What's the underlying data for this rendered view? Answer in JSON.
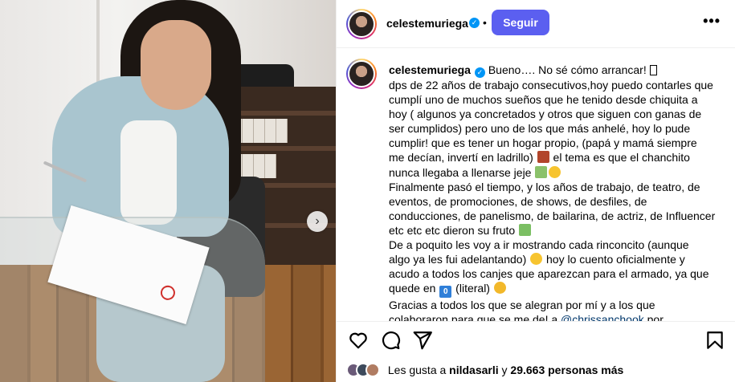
{
  "post": {
    "username": "celestemuriega",
    "follow_label": "Seguir",
    "separator": "•",
    "more_label": "•••",
    "next_label": "›",
    "caption_lines": [
      "Bueno…. No sé cómo arrancar! ",
      "dps de 22 años de trabajo consecutivos,hoy puedo contarles que",
      "cumplí uno de muchos sueños que he tenido desde chiquita a",
      "hoy ( algunos ya concretados y otros que siguen con ganas de",
      "ser cumplidos) pero uno de los que más anhelé, hoy lo pude",
      "cumplir! que es tener un hogar propio, (papá y mamá siempre",
      "me decían, invertí en ladrillo) ",
      " el tema es que el chanchito",
      "nunca llegaba a llenarse jeje ",
      "Finalmente pasó el tiempo, y los años de trabajo, de teatro, de",
      "eventos, de promociones, de shows, de desfiles, de",
      "conducciones, de panelismo, de bailarina, de actriz, de Influencer",
      "etc etc etc dieron su fruto ",
      "De a poquito les voy a ir mostrando cada rinconcito (aunque",
      "algo ya les fui adelantando) ",
      " hoy lo cuento oficialmente y",
      "acudo a todos los canjes que aparezcan para el armado, ya que",
      "quede en ",
      " (literal) ",
      "Gracias a todos los que se alegran por mí y a los que",
      "colaboraron para que se me de! a ",
      "@chrissanchook",
      " por"
    ],
    "zero_emoji_label": "0",
    "likes": {
      "prefix": "Les gusta a",
      "user": "nildasarli",
      "middle": "y",
      "count": "29.663 personas más"
    }
  },
  "icons": {
    "like": "heart-icon",
    "comment": "comment-icon",
    "share": "share-icon",
    "save": "bookmark-icon",
    "verified": "verified-badge-icon",
    "next": "chevron-right-icon"
  },
  "colors": {
    "follow_button": "#5b5ff0",
    "verified": "#0095f6",
    "mention": "#00376b"
  }
}
